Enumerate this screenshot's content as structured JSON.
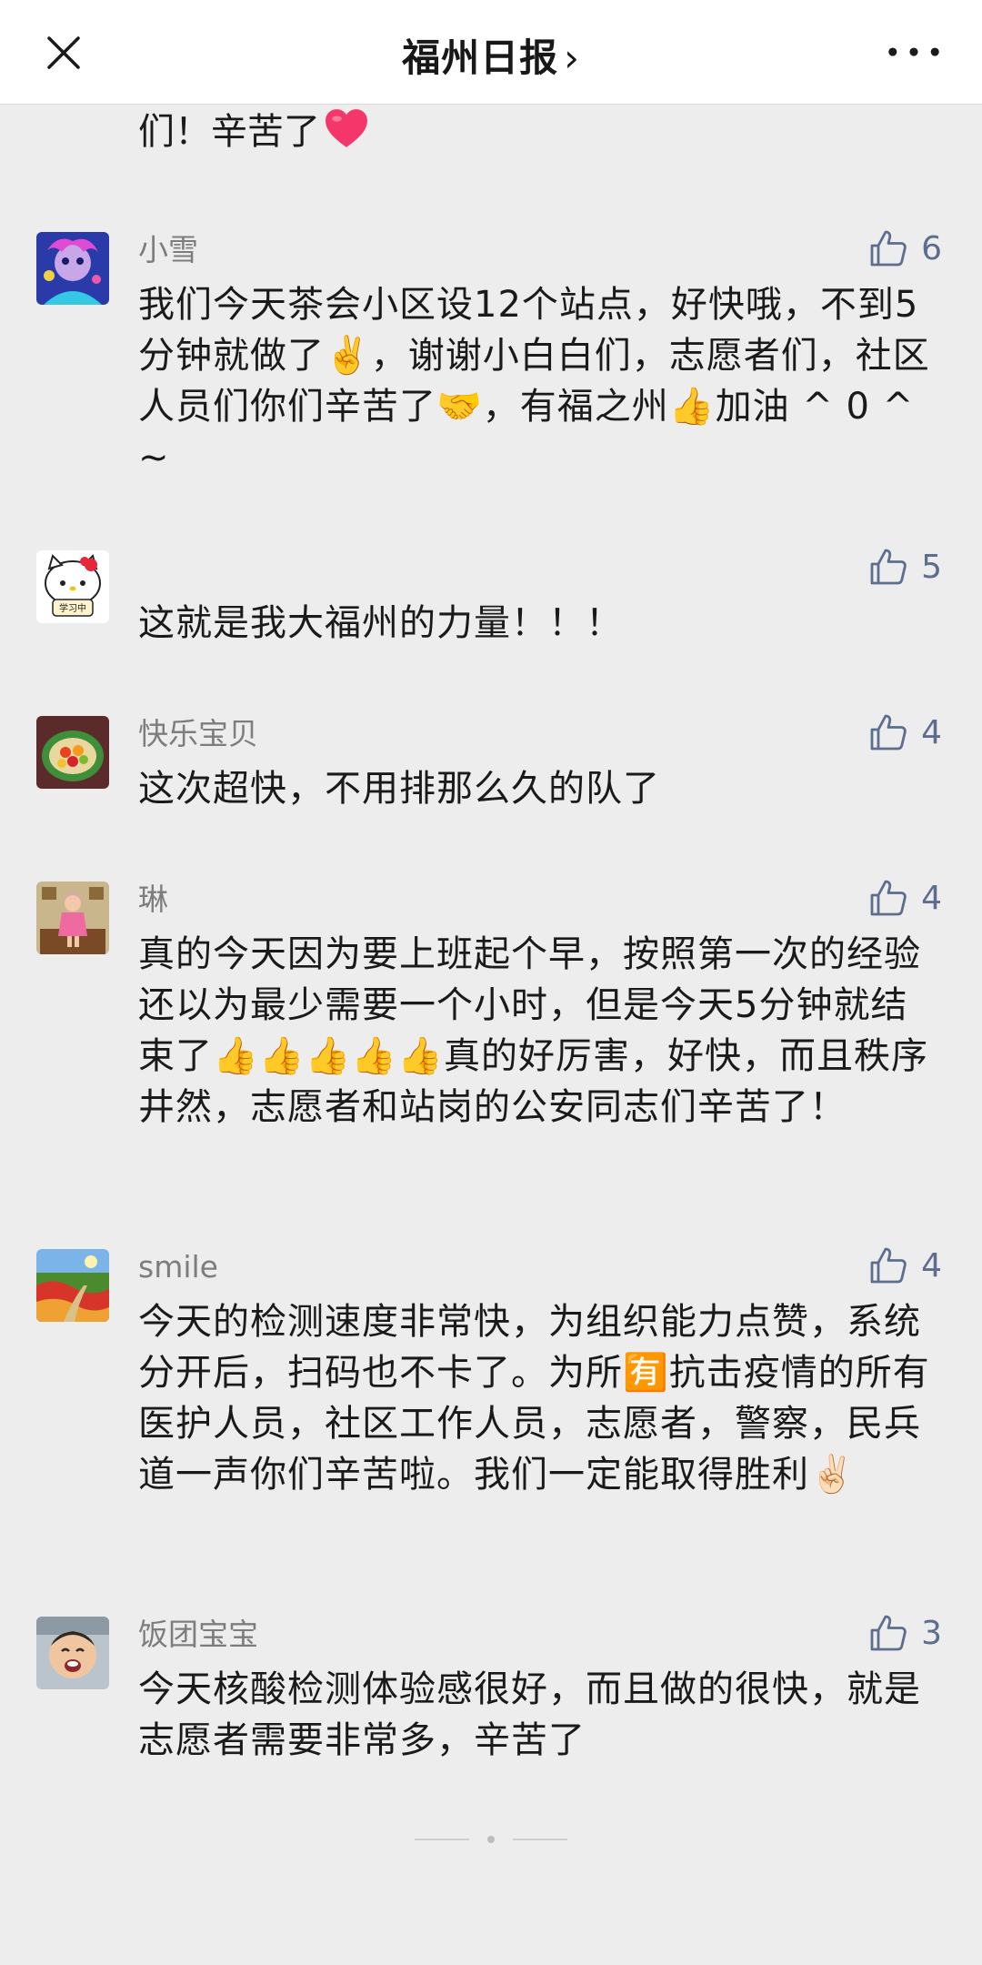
{
  "header": {
    "title": "福州日报",
    "chevron": "›"
  },
  "partial_comment": {
    "text": "们！辛苦了"
  },
  "comments": [
    {
      "username": "小雪",
      "likes": "6",
      "text": "我们今天茶会小区设12个站点，好快哦，不到5分钟就做了✌️，谢谢小白白们，志愿者们，社区人员们你们辛苦了🤝，有福之州👍加油 ^ 0 ^ ~"
    },
    {
      "username": "",
      "likes": "5",
      "text": "这就是我大福州的力量！！！"
    },
    {
      "username": "快乐宝贝",
      "likes": "4",
      "text": "这次超快，不用排那么久的队了"
    },
    {
      "username": "琳",
      "likes": "4",
      "text": "真的今天因为要上班起个早，按照第一次的经验还以为最少需要一个小时，但是今天5分钟就结束了👍👍👍👍👍真的好厉害，好快，而且秩序井然，志愿者和站岗的公安同志们辛苦了！"
    },
    {
      "username": "smile",
      "likes": "4",
      "text": "今天的检测速度非常快，为组织能力点赞，系统分开后，扫码也不卡了。为所🈶抗击疫情的所有医护人员，社区工作人员，志愿者，警察，民兵道一声你们辛苦啦。我们一定能取得胜利✌🏻"
    },
    {
      "username": "饭团宝宝",
      "likes": "3",
      "text": "今天核酸检测体验感很好，而且做的很快，就是志愿者需要非常多，辛苦了"
    }
  ],
  "colors": {
    "background": "#ededed",
    "like_color": "#5d6d8f",
    "username_color": "#7d7d7d"
  }
}
